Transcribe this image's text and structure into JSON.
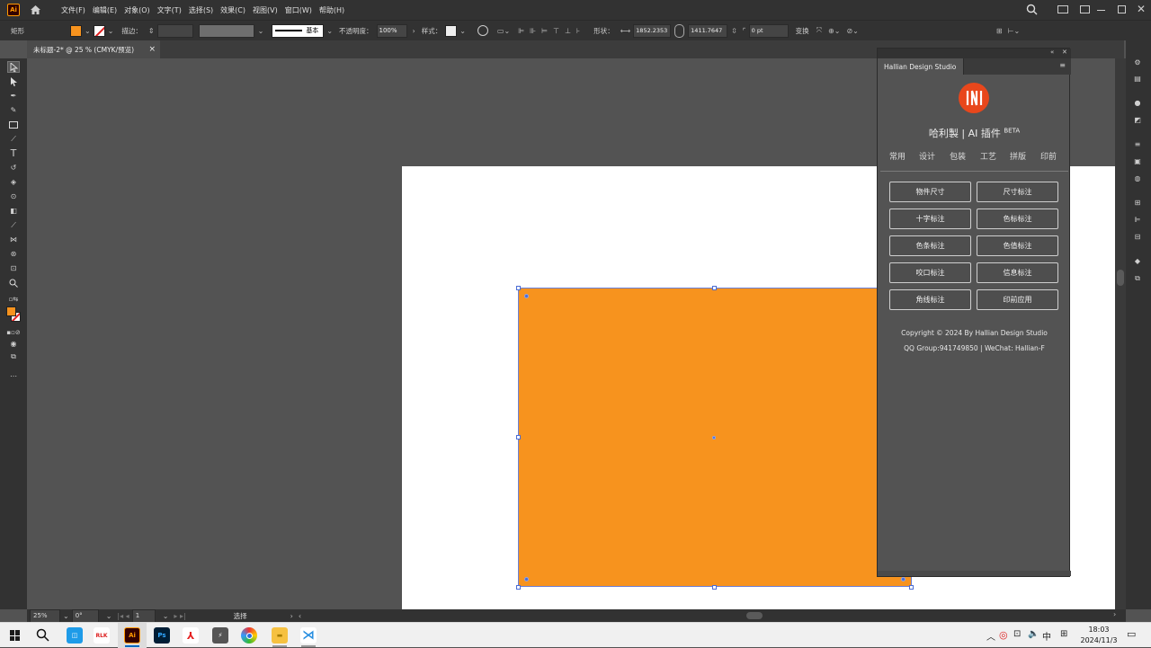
{
  "app": {
    "logo": "Ai"
  },
  "menu": [
    "文件(F)",
    "编辑(E)",
    "对象(O)",
    "文字(T)",
    "选择(S)",
    "效果(C)",
    "视图(V)",
    "窗口(W)",
    "帮助(H)"
  ],
  "control": {
    "tool_name": "矩形",
    "stroke_label": "描边：",
    "stroke_style": "基本",
    "opacity_label": "不透明度：",
    "opacity_value": "100%",
    "style_label": "样式：",
    "shape_label": "形状：",
    "width_value": "1852.2353",
    "height_value": "1411.7647",
    "corner_value": "0 pt",
    "transform_label": "变换"
  },
  "document": {
    "tab_title": "未标题-2* @ 25 % (CMYK/预览)",
    "close": "×"
  },
  "colors": {
    "fill": "#f7931e",
    "panel_logo": "#e8471c"
  },
  "plugin": {
    "tab_title": "Hallian Design Studio",
    "title": "哈利製 | AI 插件",
    "beta": "BETA",
    "categories": [
      "常用",
      "设计",
      "包装",
      "工艺",
      "拼版",
      "印前"
    ],
    "buttons": [
      "物件尺寸",
      "尺寸标注",
      "十字标注",
      "色标标注",
      "色条标注",
      "色值标注",
      "咬口标注",
      "信息标注",
      "角线标注",
      "印前应用"
    ],
    "copyright": "Copyright © 2024 By Hallian Design Studio",
    "contact": "QQ Group:941749850 | WeChat: Hallian-F"
  },
  "status": {
    "zoom": "25%",
    "rotation": "0°",
    "artboard": "1",
    "mode": "选择"
  },
  "taskbar": {
    "time": "18:03",
    "date": "2024/11/3",
    "ime": "中"
  }
}
